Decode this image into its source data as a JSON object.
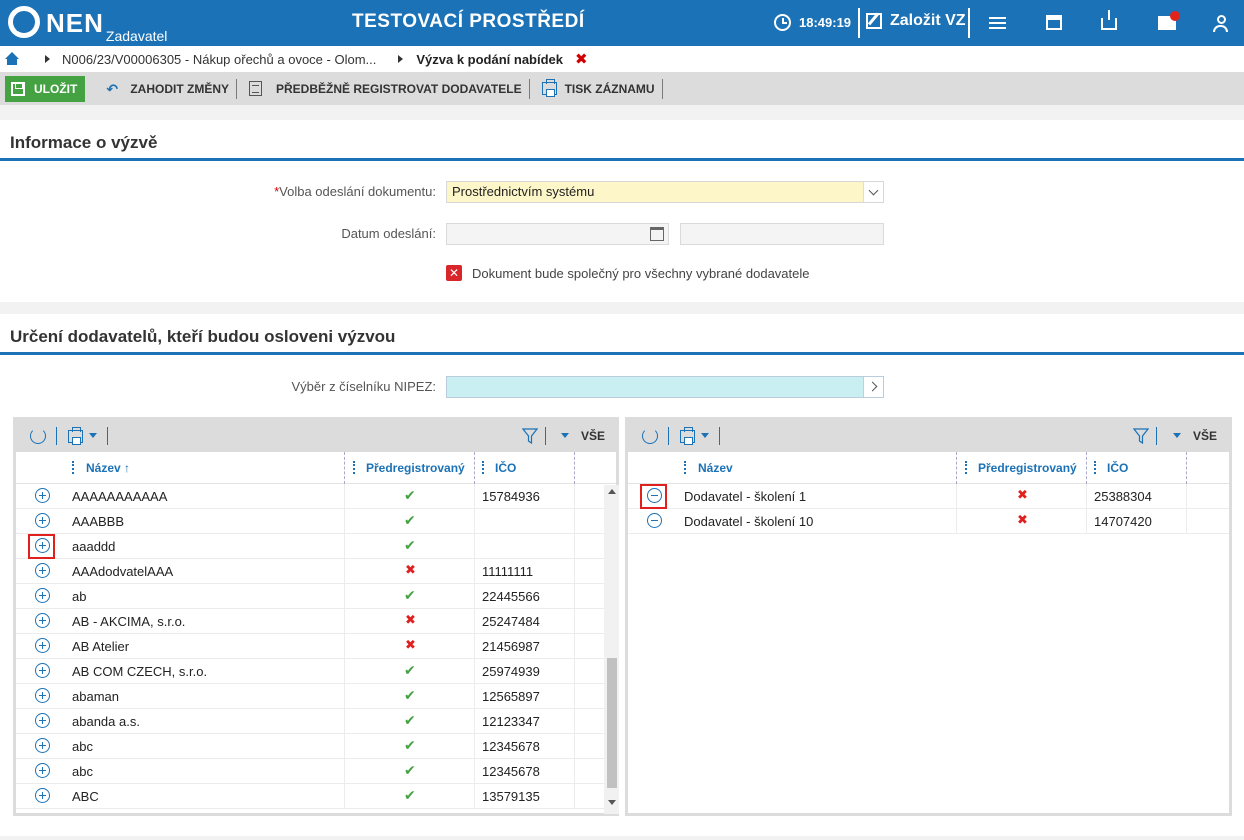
{
  "header": {
    "logo_text": "NEN",
    "logo_sub": "Zadavatel",
    "env_title": "TESTOVACÍ PROSTŘEDÍ",
    "clock": "18:49:19",
    "create_label": "Založit VZ",
    "icons": [
      "menu-icon",
      "calendar-icon",
      "inbox-icon",
      "mail-icon",
      "user-icon"
    ]
  },
  "breadcrumb": {
    "item1": "N006/23/V00006305 - Nákup ořechů a ovoce - Olom...",
    "current": "Výzva k podání nabídek",
    "close": "✖"
  },
  "toolbar": {
    "save": "ULOŽIT",
    "discard": "ZAHODIT ZMĚNY",
    "preregister": "PŘEDBĚŽNĚ REGISTROVAT DODAVATELE",
    "print": "TISK ZÁZNAMU"
  },
  "info_section": {
    "title": "Informace o výzvě",
    "send_choice_label": "Volba odeslání dokumentu:",
    "send_choice_value": "Prostřednictvím systému",
    "send_date_label": "Datum odeslání:",
    "shared_doc_label": "Dokument bude společný pro všechny vybrané dodavatele",
    "shared_doc_checked": false
  },
  "suppliers_section": {
    "title": "Určení dodavatelů, kteří budou osloveni výzvou",
    "nipez_label": "Výběr z číselníku NIPEZ:"
  },
  "left_grid": {
    "all_label": "VŠE",
    "columns": {
      "name": "Název ↑",
      "prereg": "Předregistrovaný",
      "ico": "IČO"
    },
    "rows": [
      {
        "name": "AAAAAAAAAAA",
        "prereg": true,
        "ico": "15784936"
      },
      {
        "name": "AAABBB",
        "prereg": true,
        "ico": ""
      },
      {
        "name": "aaaddd",
        "prereg": true,
        "ico": "",
        "highlight": true
      },
      {
        "name": "AAAdodvatelAAA",
        "prereg": false,
        "ico": "11111111"
      },
      {
        "name": "ab",
        "prereg": true,
        "ico": "22445566"
      },
      {
        "name": "AB - AKCIMA, s.r.o.",
        "prereg": false,
        "ico": "25247484"
      },
      {
        "name": "AB Atelier",
        "prereg": false,
        "ico": "21456987"
      },
      {
        "name": "AB COM CZECH, s.r.o.",
        "prereg": true,
        "ico": "25974939"
      },
      {
        "name": "abaman",
        "prereg": true,
        "ico": "12565897"
      },
      {
        "name": "abanda a.s.",
        "prereg": true,
        "ico": "12123347"
      },
      {
        "name": "abc",
        "prereg": true,
        "ico": "12345678"
      },
      {
        "name": "abc",
        "prereg": true,
        "ico": "12345678"
      },
      {
        "name": "ABC",
        "prereg": true,
        "ico": "13579135"
      }
    ]
  },
  "right_grid": {
    "all_label": "VŠE",
    "columns": {
      "name": "Název",
      "prereg": "Předregistrovaný",
      "ico": "IČO"
    },
    "rows": [
      {
        "name": "Dodavatel - školení 1",
        "prereg": false,
        "ico": "25388304",
        "highlight": true
      },
      {
        "name": "Dodavatel - školení 10",
        "prereg": false,
        "ico": "14707420"
      }
    ]
  }
}
